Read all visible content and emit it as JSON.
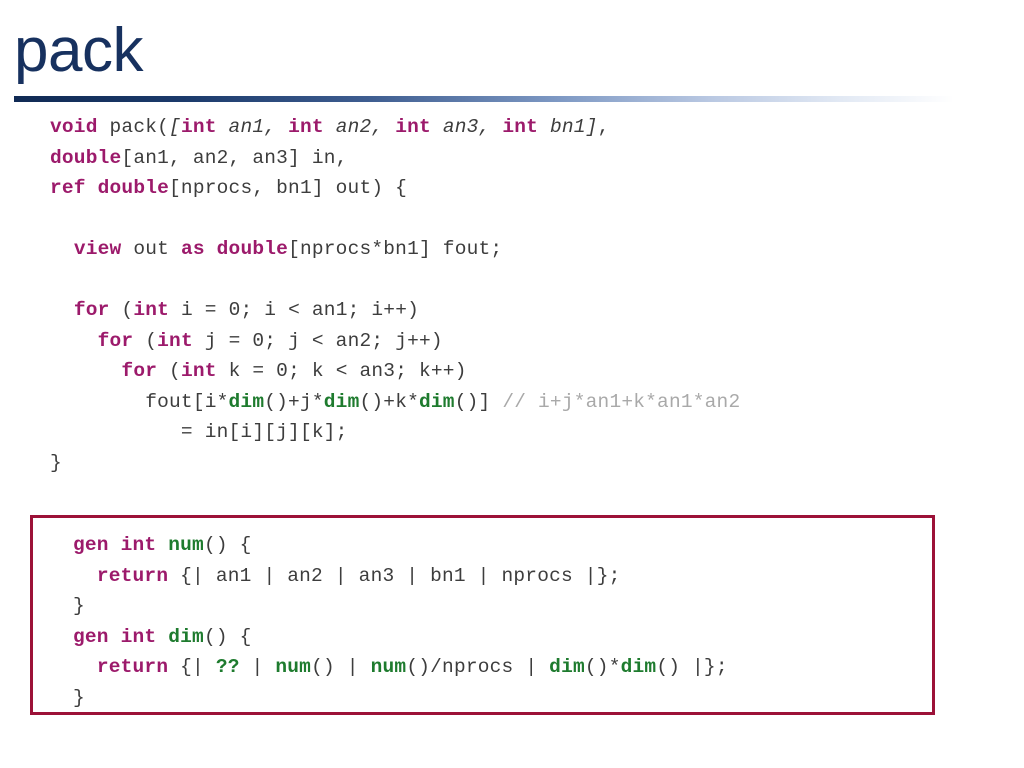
{
  "slide": {
    "title": "pack",
    "title_color": "#17315f",
    "rule_color_start": "#102a54",
    "rule_color_end": "#ffffff"
  },
  "theme": {
    "keyword_color": "#9c1a6b",
    "function_color": "#1e7b2e",
    "comment_color": "#a9a9a9",
    "plain_color": "#3d3d3d",
    "box_border_color": "#9c1138",
    "background_color": "#ffffff"
  },
  "code_main": {
    "name": "pack-function-source",
    "lines": [
      [
        {
          "t": "void",
          "c": "kw"
        },
        {
          "t": " pack(",
          "c": "plain"
        },
        {
          "t": "[",
          "c": "param"
        },
        {
          "t": "int",
          "c": "kw"
        },
        {
          "t": " an1",
          "c": "param"
        },
        {
          "t": ", ",
          "c": "param"
        },
        {
          "t": "int",
          "c": "kw"
        },
        {
          "t": " an2",
          "c": "param"
        },
        {
          "t": ", ",
          "c": "param"
        },
        {
          "t": "int",
          "c": "kw"
        },
        {
          "t": " an3",
          "c": "param"
        },
        {
          "t": ", ",
          "c": "param"
        },
        {
          "t": "int",
          "c": "kw"
        },
        {
          "t": " bn1]",
          "c": "param"
        },
        {
          "t": ",",
          "c": "plain"
        }
      ],
      [
        {
          "t": "double",
          "c": "kw"
        },
        {
          "t": "[an1, an2, an3] in,",
          "c": "plain"
        }
      ],
      [
        {
          "t": "ref double",
          "c": "kw"
        },
        {
          "t": "[nprocs, bn1] out) {",
          "c": "plain"
        }
      ],
      [],
      [
        {
          "t": "  ",
          "c": "plain"
        },
        {
          "t": "view",
          "c": "kw"
        },
        {
          "t": " out ",
          "c": "plain"
        },
        {
          "t": "as double",
          "c": "kw"
        },
        {
          "t": "[nprocs*bn1] fout;",
          "c": "plain"
        }
      ],
      [],
      [
        {
          "t": "  ",
          "c": "plain"
        },
        {
          "t": "for",
          "c": "kw"
        },
        {
          "t": " (",
          "c": "plain"
        },
        {
          "t": "int",
          "c": "kw"
        },
        {
          "t": " i = 0; i < an1; i++)",
          "c": "plain"
        }
      ],
      [
        {
          "t": "    ",
          "c": "plain"
        },
        {
          "t": "for",
          "c": "kw"
        },
        {
          "t": " (",
          "c": "plain"
        },
        {
          "t": "int",
          "c": "kw"
        },
        {
          "t": " j = 0; j < an2; j++)",
          "c": "plain"
        }
      ],
      [
        {
          "t": "      ",
          "c": "plain"
        },
        {
          "t": "for",
          "c": "kw"
        },
        {
          "t": " (",
          "c": "plain"
        },
        {
          "t": "int",
          "c": "kw"
        },
        {
          "t": " k = 0; k < an3; k++)",
          "c": "plain"
        }
      ],
      [
        {
          "t": "        fout[i*",
          "c": "plain"
        },
        {
          "t": "dim",
          "c": "fn"
        },
        {
          "t": "()+j*",
          "c": "plain"
        },
        {
          "t": "dim",
          "c": "fn"
        },
        {
          "t": "()+k*",
          "c": "plain"
        },
        {
          "t": "dim",
          "c": "fn"
        },
        {
          "t": "()] ",
          "c": "plain"
        },
        {
          "t": "// i+j*an1+k*an1*an2",
          "c": "comment"
        }
      ],
      [
        {
          "t": "           = in[i][j][k];",
          "c": "plain"
        }
      ],
      [
        {
          "t": "}",
          "c": "plain"
        }
      ]
    ]
  },
  "code_boxed": {
    "name": "gen-functions-source",
    "lines": [
      [
        {
          "t": "gen int ",
          "c": "kw"
        },
        {
          "t": "num",
          "c": "fn"
        },
        {
          "t": "() {",
          "c": "plain"
        }
      ],
      [
        {
          "t": "  ",
          "c": "plain"
        },
        {
          "t": "return",
          "c": "kw"
        },
        {
          "t": " {| an1 | an2 | an3 | bn1 | nprocs |};",
          "c": "plain"
        }
      ],
      [
        {
          "t": "}",
          "c": "plain"
        }
      ],
      [
        {
          "t": "gen int ",
          "c": "kw"
        },
        {
          "t": "dim",
          "c": "fn"
        },
        {
          "t": "() {",
          "c": "plain"
        }
      ],
      [
        {
          "t": "  ",
          "c": "plain"
        },
        {
          "t": "return",
          "c": "kw"
        },
        {
          "t": " {| ",
          "c": "plain"
        },
        {
          "t": "??",
          "c": "fn"
        },
        {
          "t": " | ",
          "c": "plain"
        },
        {
          "t": "num",
          "c": "fn"
        },
        {
          "t": "()",
          "c": "plain"
        },
        {
          "t": " | ",
          "c": "plain"
        },
        {
          "t": "num",
          "c": "fn"
        },
        {
          "t": "()/nprocs | ",
          "c": "plain"
        },
        {
          "t": "dim",
          "c": "fn"
        },
        {
          "t": "()*",
          "c": "plain"
        },
        {
          "t": "dim",
          "c": "fn"
        },
        {
          "t": "() |};",
          "c": "plain"
        }
      ],
      [
        {
          "t": "}",
          "c": "plain"
        }
      ]
    ]
  }
}
